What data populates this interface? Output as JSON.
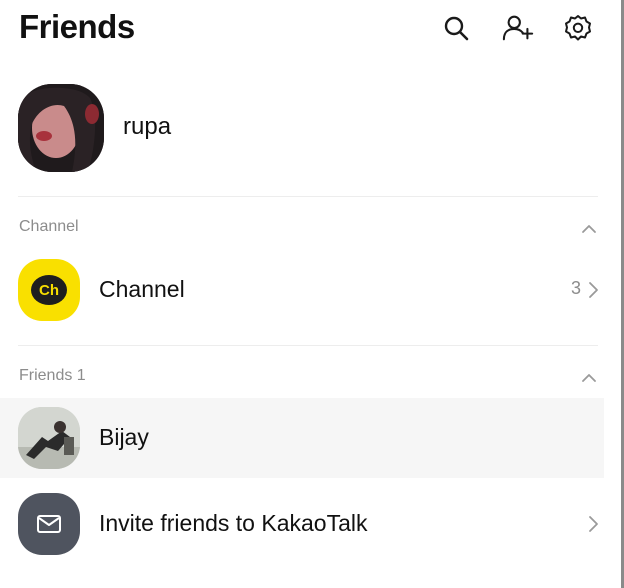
{
  "header": {
    "title": "Friends",
    "icons": [
      "search-icon",
      "add-friend-icon",
      "settings-icon"
    ]
  },
  "profile": {
    "name": "rupa"
  },
  "channel_section": {
    "label": "Channel",
    "item": {
      "icon_text": "Ch",
      "label": "Channel",
      "count": "3",
      "accent": "#f9e000"
    }
  },
  "friends_section": {
    "label": "Friends 1",
    "items": [
      {
        "name": "Bijay"
      }
    ]
  },
  "invite": {
    "label": "Invite friends to KakaoTalk",
    "icon": "mail-icon",
    "icon_bg": "#4f545f"
  }
}
